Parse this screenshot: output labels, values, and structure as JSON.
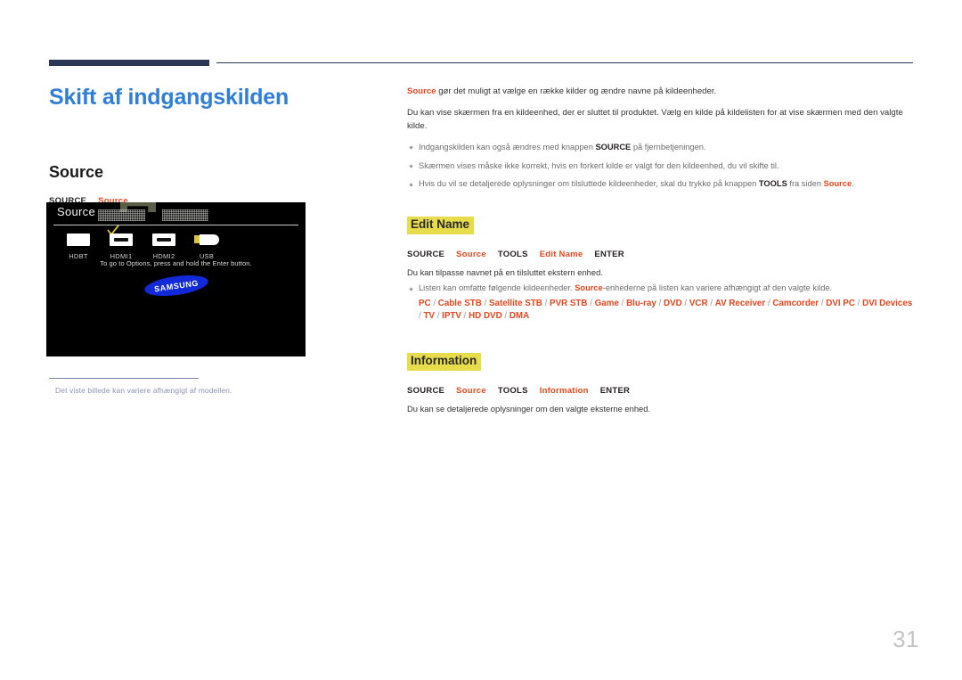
{
  "colors": {
    "title_blue": "#2f7fd6",
    "rule_navy": "#2c3655",
    "accent_red": "#e8461e",
    "highlight_yellow": "#e7dc4b",
    "caption_gray_blue": "#8c93b2",
    "page_number_gray": "#c4c4c4",
    "samsung_blue": "#1229d8"
  },
  "header": {
    "rule_thick": "",
    "rule_thin": ""
  },
  "left": {
    "page_title": "Skift af indgangskilden",
    "section_title": "Source",
    "keypath": {
      "source_key": "SOURCE",
      "source_menu": "Source"
    },
    "caption": "Det viste billede kan variere afhængigt af modellen."
  },
  "tv_screenshot": {
    "title": "Source",
    "hint": "To go to Options, press and hold the Enter button.",
    "logo": "SAMSUNG",
    "inputs": [
      {
        "label": "HDBT",
        "type": "plain",
        "selected": false
      },
      {
        "label": "HDMI1",
        "type": "hdmi",
        "selected": true
      },
      {
        "label": "HDMI2",
        "type": "hdmi",
        "selected": false
      },
      {
        "label": "USB",
        "type": "usb",
        "selected": false
      }
    ]
  },
  "right": {
    "intro": {
      "lead_red": "Source",
      "lead_rest": " gør det muligt at vælge en række kilder og ændre navne på kildeenheder."
    },
    "paragraph2": "Du kan vise skærmen fra en kildeenhed, der er sluttet til produktet. Vælg en kilde på kildelisten for at vise skærmen med den valgte kilde.",
    "bullets": [
      {
        "pre": "Indgangskilden kan også ændres med knappen ",
        "bold": "SOURCE",
        "post": " på fjernbetjeningen."
      },
      {
        "pre": "Skærmen vises måske ikke korrekt, hvis en forkert kilde er valgt for den kildeenhed, du vil skifte til.",
        "bold": "",
        "post": ""
      },
      {
        "pre": "Hvis du vil se detaljerede oplysninger om tilsluttede kildeenheder, skal du trykke på knappen ",
        "bold": "TOOLS",
        "post": " fra siden ",
        "tail_red": "Source",
        "tail_end": "."
      }
    ],
    "edit_name": {
      "heading": "Edit Name",
      "keypath": {
        "k1": "SOURCE",
        "k2": "Source",
        "k3": "TOOLS",
        "k4": "Edit Name",
        "k5": "ENTER"
      },
      "description": "Du kan tilpasse navnet på en tilsluttet ekstern enhed.",
      "bullet_pre": "Listen kan omfatte følgende kildeenheder. ",
      "bullet_red": "Source",
      "bullet_post": "-enhederne på listen kan variere afhængigt af den valgte kilde.",
      "devices": [
        "PC",
        "Cable STB",
        "Satellite STB",
        "PVR STB",
        "Game",
        "Blu-ray",
        "DVD",
        "VCR",
        "AV Receiver",
        "Camcorder",
        "DVI PC",
        "DVI Devices",
        "TV",
        "IPTV",
        "HD DVD",
        "DMA"
      ],
      "device_separator": "/"
    },
    "information": {
      "heading": "Information",
      "keypath": {
        "k1": "SOURCE",
        "k2": "Source",
        "k3": "TOOLS",
        "k4": "Information",
        "k5": "ENTER"
      },
      "description": "Du kan se detaljerede oplysninger om den valgte eksterne enhed."
    }
  },
  "footer": {
    "page_number": "31"
  }
}
